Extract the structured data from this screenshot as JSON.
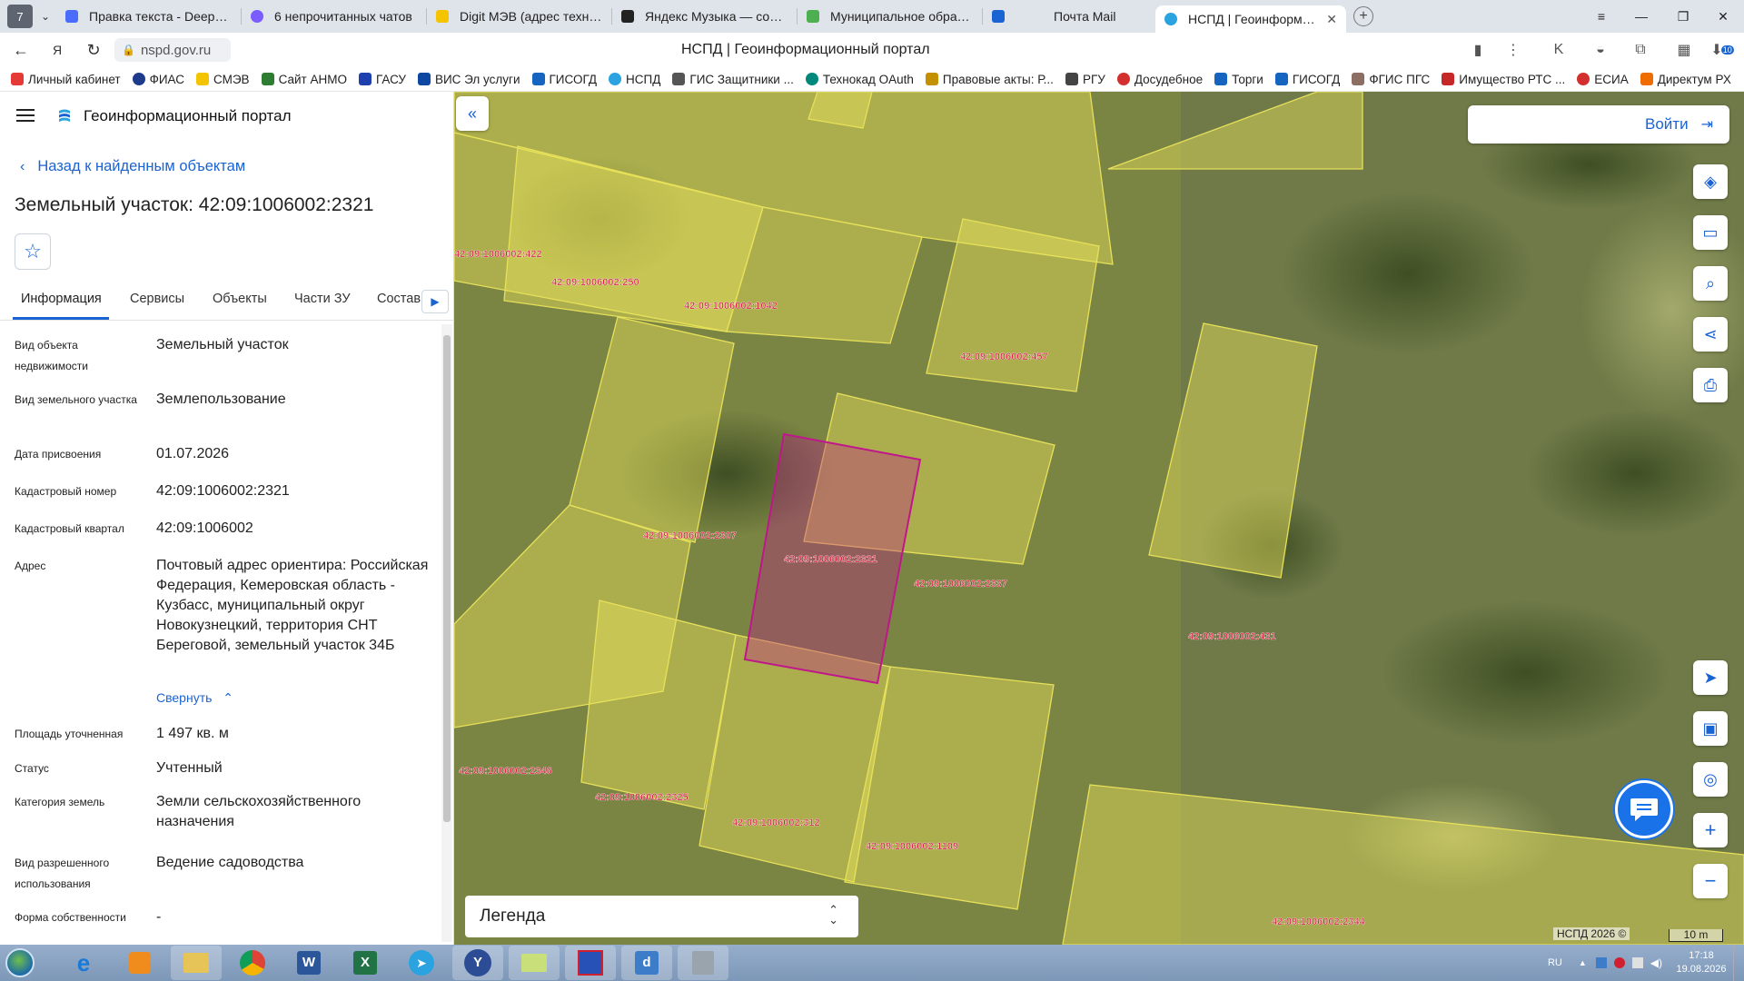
{
  "browser": {
    "tab_counter": "7",
    "tabs": [
      {
        "title": "Правка текста - DeepSee",
        "color": "#4b6bfb"
      },
      {
        "title": "6 непрочитанных чатов",
        "color": "#7b5cff"
      },
      {
        "title": "Digit МЭВ (адрес технич",
        "color": "#f5c400"
      },
      {
        "title": "Яндекс Музыка — собира",
        "color": "#222222"
      },
      {
        "title": "Муниципальное образова",
        "color": "#4caf50"
      },
      {
        "title": "Почта Mail",
        "color": "#1a63d3"
      },
      {
        "title": "НСПД | Геоинформаци",
        "color": "#2aa3e0"
      }
    ],
    "url": "nspd.gov.ru",
    "page_title": "НСПД | Геоинформационный портал",
    "downloads_badge": "10",
    "bookmarks": [
      {
        "label": "Личный кабинет",
        "color": "#e53935"
      },
      {
        "label": "ФИАС",
        "color": "#1e3a8a"
      },
      {
        "label": "СМЭВ",
        "color": "#f5c400"
      },
      {
        "label": "Сайт АНМО",
        "color": "#2e7d32"
      },
      {
        "label": "ГАСУ",
        "color": "#1e40af"
      },
      {
        "label": "ВИС Эл услуги",
        "color": "#0d47a1"
      },
      {
        "label": "ГИСОГД",
        "color": "#1565c0"
      },
      {
        "label": "НСПД",
        "color": "#2aa3e0"
      },
      {
        "label": "ГИС Защитники ...",
        "color": "#555555"
      },
      {
        "label": "Технокад OAuth",
        "color": "#00897b"
      },
      {
        "label": "Правовые акты: Р...",
        "color": "#c49000"
      },
      {
        "label": "РГУ",
        "color": "#444444"
      },
      {
        "label": "Досудебное",
        "color": "#d32f2f"
      },
      {
        "label": "Торги",
        "color": "#1565c0"
      },
      {
        "label": "ГИСОГД",
        "color": "#1565c0"
      },
      {
        "label": "ФГИС ПГС",
        "color": "#8d6e63"
      },
      {
        "label": "Имущество РТС ...",
        "color": "#c62828"
      },
      {
        "label": "ЕСИА",
        "color": "#d32f2f"
      },
      {
        "label": "Директум РХ",
        "color": "#ef6c00"
      }
    ]
  },
  "panel": {
    "portal_name": "Геоинформационный портал",
    "back_link": "Назад к найденным объектам",
    "title": "Земельный участок: 42:09:1006002:2321",
    "tabs": [
      "Информация",
      "Сервисы",
      "Объекты",
      "Части ЗУ",
      "Состав"
    ],
    "properties": [
      {
        "label": "Вид объекта недвижимости",
        "value": "Земельный участок"
      },
      {
        "label": "Вид земельного участка",
        "value": "Землепользование"
      },
      {
        "label": "Дата присвоения",
        "value": "01.07.2026"
      },
      {
        "label": "Кадастровый номер",
        "value": "42:09:1006002:2321"
      },
      {
        "label": "Кадастровый квартал",
        "value": "42:09:1006002"
      },
      {
        "label": "Адрес",
        "value": "Почтовый адрес ориентира: Российская Федерация, Кемеровская область - Кузбасс, муниципальный округ Новокузнецкий, территория СНТ Береговой, земельный участок 34Б"
      },
      {
        "label": "Площадь уточненная",
        "value": "1 497 кв. м"
      },
      {
        "label": "Статус",
        "value": "Учтенный"
      },
      {
        "label": "Категория земель",
        "value": "Земли сельскохозяйственного назначения"
      },
      {
        "label": "Вид разрешенного использования",
        "value": "Ведение садоводства"
      },
      {
        "label": "Форма собственности",
        "value": "-"
      }
    ],
    "collapse_link": "Свернуть"
  },
  "map": {
    "login_label": "Войти",
    "legend_label": "Легенда",
    "copyright": "НСПД 2026 ©",
    "scale_label": "10 m",
    "parcels": [
      "42:09:1006002:2321",
      "42:09:1006002:422",
      "42:09:1006002:250",
      "42:09:1006002:1042",
      "42:09:1006002:457",
      "42:09:1006002:2307",
      "42:09:1006002:2337",
      "42:09:1006002:431",
      "42:09:1006002:2346",
      "42:09:1006002:2325",
      "42:09:1006002:312",
      "42:09:1006002:1109",
      "42:09:1006002:2344"
    ],
    "colors": {
      "parcel_fill": "#e8e35a",
      "parcel_stroke": "#e6e05a",
      "selected_stroke": "#c0168c",
      "label_color": "#d21f3c"
    }
  },
  "taskbar": {
    "apps": [
      "IE",
      "Media",
      "Explorer",
      "Chrome",
      "Word",
      "Excel",
      "Telegram",
      "Yandex",
      "Folder",
      "App",
      "App2",
      "Archive"
    ],
    "lang": "RU",
    "time": "17:18",
    "date": "19.08.2026"
  }
}
